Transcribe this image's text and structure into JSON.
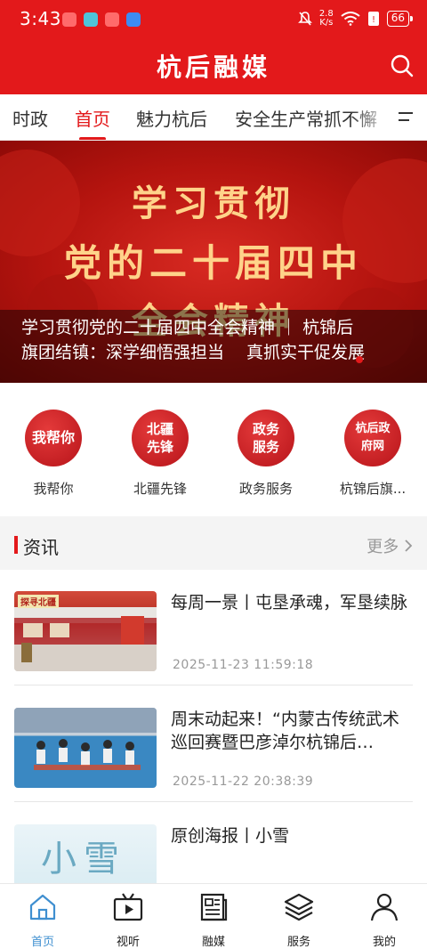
{
  "status_bar": {
    "time": "3:43",
    "speed_value": "2.8",
    "speed_unit": "K/s",
    "battery": "66"
  },
  "header": {
    "title": "杭后融媒"
  },
  "tabs": [
    "时政",
    "首页",
    "魅力杭后",
    "安全生产常抓不懈"
  ],
  "active_tab": "首页",
  "banner": {
    "image_lines": [
      "学习贯彻",
      "党的二十届四中",
      "全会精神"
    ],
    "caption_line1": "学习贯彻党的二十届四中全会精神 ｜ 杭锦后",
    "caption_line2": "旗团结镇：深学细悟强担当　 真抓实干促发展"
  },
  "quick_entries": [
    {
      "icon_text": "我帮你",
      "label": "我帮你"
    },
    {
      "icon_text": "北疆先锋",
      "label": "北疆先锋"
    },
    {
      "icon_text": "政务服务",
      "label": "政务服务"
    },
    {
      "icon_text": "杭后政府网",
      "label": "杭锦后旗..."
    }
  ],
  "news_section": {
    "title": "资讯",
    "more": "更多"
  },
  "news": [
    {
      "title": "每周一景丨屯垦承魂，军垦续脉",
      "date": "2025-11-23  11:59:18",
      "thumb_text": "探寻北疆"
    },
    {
      "title": "周末动起来！“内蒙古传统武术巡回赛暨巴彦淖尔杭锦后…",
      "date": "2025-11-22  20:38:39",
      "thumb_text": ""
    },
    {
      "title": "原创海报丨小雪",
      "date": "",
      "thumb_text": "小雪"
    }
  ],
  "bottom_nav": [
    {
      "label": "首页",
      "icon": "home-icon",
      "active": true
    },
    {
      "label": "视听",
      "icon": "video-icon",
      "active": false
    },
    {
      "label": "融媒",
      "icon": "newspaper-icon",
      "active": false
    },
    {
      "label": "服务",
      "icon": "layers-icon",
      "active": false
    },
    {
      "label": "我的",
      "icon": "user-icon",
      "active": false
    }
  ],
  "colors": {
    "brand_red": "#e3191b",
    "active_nav_blue": "#3f8fd0"
  }
}
